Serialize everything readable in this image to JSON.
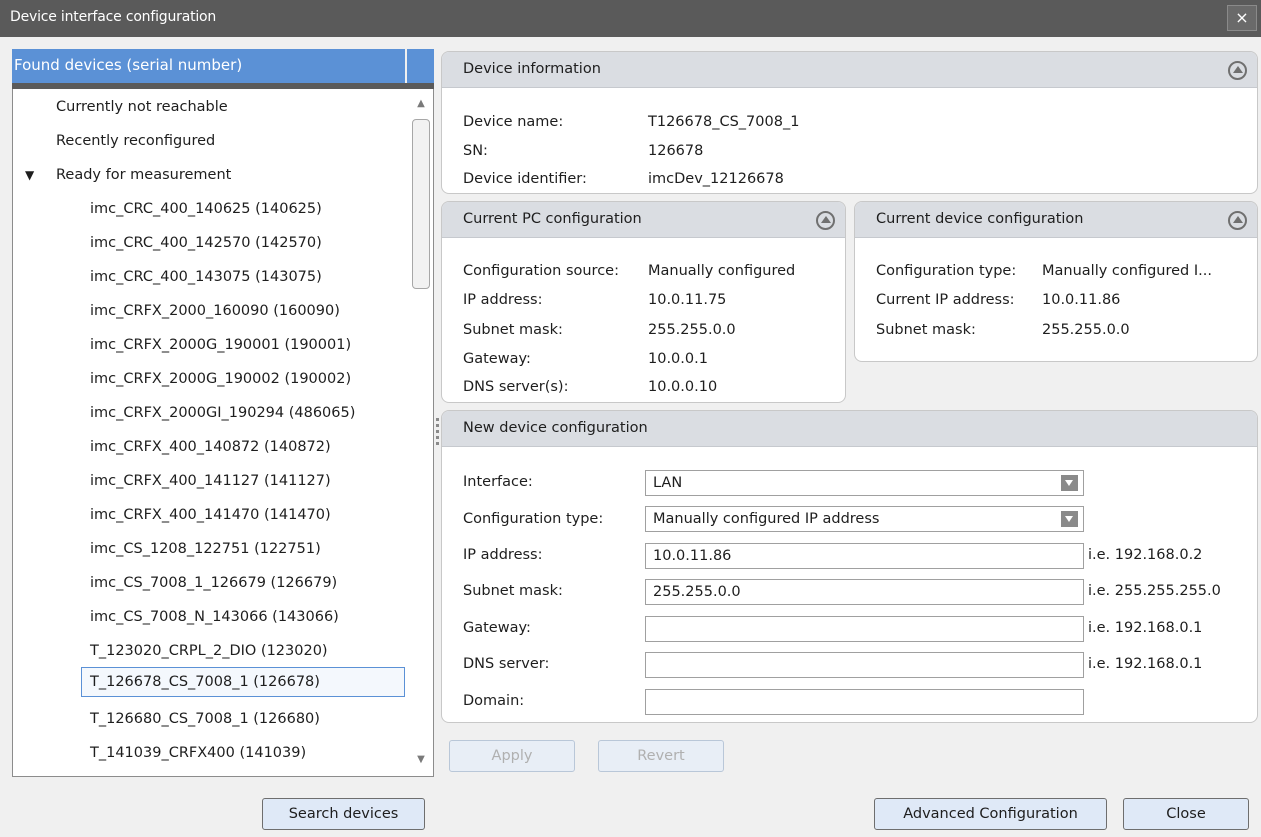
{
  "window": {
    "title": "Device interface configuration",
    "close_glyph": "×"
  },
  "left": {
    "header": "Found devices (serial number)",
    "groups": [
      "Currently not reachable",
      "Recently reconfigured",
      "Ready for measurement"
    ],
    "expanded_arrow": "▼",
    "devices": [
      "imc_CRC_400_140625 (140625)",
      "imc_CRC_400_142570 (142570)",
      "imc_CRC_400_143075 (143075)",
      "imc_CRFX_2000_160090 (160090)",
      "imc_CRFX_2000G_190001 (190001)",
      "imc_CRFX_2000G_190002 (190002)",
      "imc_CRFX_2000GI_190294 (486065)",
      "imc_CRFX_400_140872 (140872)",
      "imc_CRFX_400_141127 (141127)",
      "imc_CRFX_400_141470 (141470)",
      "imc_CS_1208_122751 (122751)",
      "imc_CS_7008_1_126679 (126679)",
      "imc_CS_7008_N_143066 (143066)",
      "T_123020_CRPL_2_DIO (123020)",
      "T_126678_CS_7008_1 (126678)",
      "T_126680_CS_7008_1 (126680)",
      "T_141039_CRFX400 (141039)"
    ],
    "selected_index": 14,
    "search_button": "Search devices"
  },
  "device_info": {
    "title": "Device information",
    "labels": [
      "Device name:",
      "SN:",
      "Device identifier:"
    ],
    "values": [
      "T126678_CS_7008_1",
      "126678",
      "imcDev_12126678"
    ]
  },
  "pc_config": {
    "title": "Current PC configuration",
    "labels": [
      "Configuration source:",
      "IP address:",
      "Subnet mask:",
      "Gateway:",
      "DNS server(s):"
    ],
    "values": [
      "Manually configured",
      "10.0.11.75",
      "255.255.0.0",
      "10.0.0.1",
      "10.0.0.10"
    ]
  },
  "device_config": {
    "title": "Current device configuration",
    "labels": [
      "Configuration type:",
      "Current IP address:",
      "Subnet mask:"
    ],
    "values": [
      "Manually configured I...",
      "10.0.11.86",
      "255.255.0.0"
    ]
  },
  "new_config": {
    "title": "New device configuration",
    "labels": [
      "Interface:",
      "Configuration type:",
      "IP address:",
      "Subnet mask:",
      "Gateway:",
      "DNS server:",
      "Domain:"
    ],
    "interface": "LAN",
    "config_type": "Manually configured IP address",
    "ip": "10.0.11.86",
    "subnet": "255.255.0.0",
    "gateway": "",
    "dns": "",
    "domain": "",
    "hints": [
      "i.e. 192.168.0.2",
      "i.e. 255.255.255.0",
      "i.e. 192.168.0.1",
      "i.e. 192.168.0.1"
    ]
  },
  "buttons": {
    "apply": "Apply",
    "revert": "Revert",
    "advanced": "Advanced Configuration",
    "close": "Close"
  }
}
